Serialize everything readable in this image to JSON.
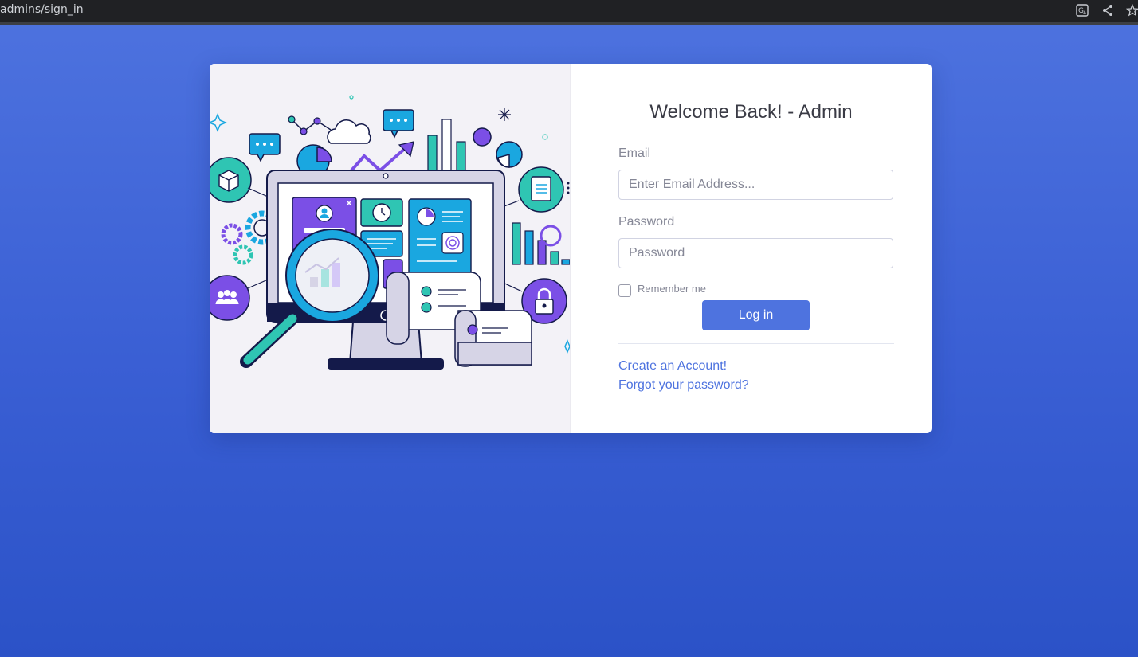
{
  "browser": {
    "url": "admins/sign_in",
    "icons": [
      "translate-icon",
      "share-icon",
      "star-icon"
    ]
  },
  "login": {
    "title": "Welcome Back! - Admin",
    "email_label": "Email",
    "email_placeholder": "Enter Email Address...",
    "email_value": "",
    "password_label": "Password",
    "password_placeholder": "Password",
    "password_value": "",
    "remember_label": "Remember me",
    "remember_checked": false,
    "login_button": "Log in",
    "create_account_link": "Create an Account!",
    "forgot_password_link": "Forgot your password?"
  },
  "colors": {
    "primary": "#4e73df",
    "background_top": "#4e73df",
    "background_bottom": "#2b52c7",
    "illustration_purple": "#7b4fe6",
    "illustration_teal": "#2fc5b3",
    "illustration_blue": "#1aa7e0",
    "illustration_navy": "#141a4a"
  }
}
